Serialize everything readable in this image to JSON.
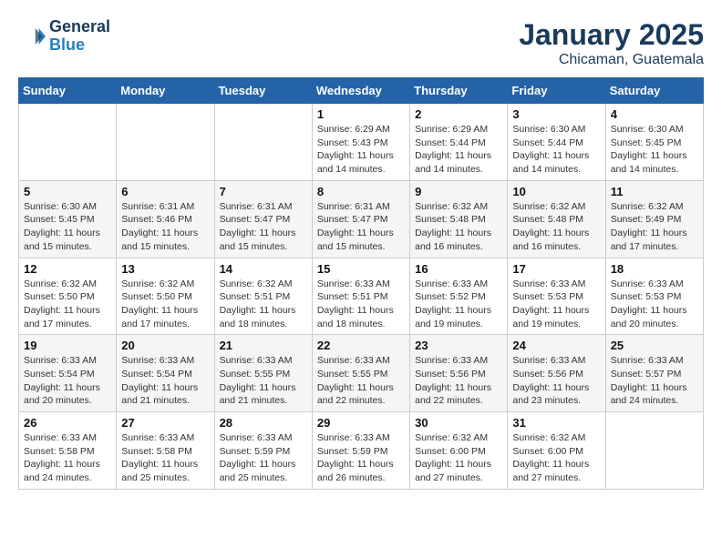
{
  "header": {
    "logo_line1": "General",
    "logo_line2": "Blue",
    "month": "January 2025",
    "location": "Chicaman, Guatemala"
  },
  "weekdays": [
    "Sunday",
    "Monday",
    "Tuesday",
    "Wednesday",
    "Thursday",
    "Friday",
    "Saturday"
  ],
  "weeks": [
    [
      {
        "day": "",
        "sunrise": "",
        "sunset": "",
        "daylight": ""
      },
      {
        "day": "",
        "sunrise": "",
        "sunset": "",
        "daylight": ""
      },
      {
        "day": "",
        "sunrise": "",
        "sunset": "",
        "daylight": ""
      },
      {
        "day": "1",
        "sunrise": "Sunrise: 6:29 AM",
        "sunset": "Sunset: 5:43 PM",
        "daylight": "Daylight: 11 hours and 14 minutes."
      },
      {
        "day": "2",
        "sunrise": "Sunrise: 6:29 AM",
        "sunset": "Sunset: 5:44 PM",
        "daylight": "Daylight: 11 hours and 14 minutes."
      },
      {
        "day": "3",
        "sunrise": "Sunrise: 6:30 AM",
        "sunset": "Sunset: 5:44 PM",
        "daylight": "Daylight: 11 hours and 14 minutes."
      },
      {
        "day": "4",
        "sunrise": "Sunrise: 6:30 AM",
        "sunset": "Sunset: 5:45 PM",
        "daylight": "Daylight: 11 hours and 14 minutes."
      }
    ],
    [
      {
        "day": "5",
        "sunrise": "Sunrise: 6:30 AM",
        "sunset": "Sunset: 5:45 PM",
        "daylight": "Daylight: 11 hours and 15 minutes."
      },
      {
        "day": "6",
        "sunrise": "Sunrise: 6:31 AM",
        "sunset": "Sunset: 5:46 PM",
        "daylight": "Daylight: 11 hours and 15 minutes."
      },
      {
        "day": "7",
        "sunrise": "Sunrise: 6:31 AM",
        "sunset": "Sunset: 5:47 PM",
        "daylight": "Daylight: 11 hours and 15 minutes."
      },
      {
        "day": "8",
        "sunrise": "Sunrise: 6:31 AM",
        "sunset": "Sunset: 5:47 PM",
        "daylight": "Daylight: 11 hours and 15 minutes."
      },
      {
        "day": "9",
        "sunrise": "Sunrise: 6:32 AM",
        "sunset": "Sunset: 5:48 PM",
        "daylight": "Daylight: 11 hours and 16 minutes."
      },
      {
        "day": "10",
        "sunrise": "Sunrise: 6:32 AM",
        "sunset": "Sunset: 5:48 PM",
        "daylight": "Daylight: 11 hours and 16 minutes."
      },
      {
        "day": "11",
        "sunrise": "Sunrise: 6:32 AM",
        "sunset": "Sunset: 5:49 PM",
        "daylight": "Daylight: 11 hours and 17 minutes."
      }
    ],
    [
      {
        "day": "12",
        "sunrise": "Sunrise: 6:32 AM",
        "sunset": "Sunset: 5:50 PM",
        "daylight": "Daylight: 11 hours and 17 minutes."
      },
      {
        "day": "13",
        "sunrise": "Sunrise: 6:32 AM",
        "sunset": "Sunset: 5:50 PM",
        "daylight": "Daylight: 11 hours and 17 minutes."
      },
      {
        "day": "14",
        "sunrise": "Sunrise: 6:32 AM",
        "sunset": "Sunset: 5:51 PM",
        "daylight": "Daylight: 11 hours and 18 minutes."
      },
      {
        "day": "15",
        "sunrise": "Sunrise: 6:33 AM",
        "sunset": "Sunset: 5:51 PM",
        "daylight": "Daylight: 11 hours and 18 minutes."
      },
      {
        "day": "16",
        "sunrise": "Sunrise: 6:33 AM",
        "sunset": "Sunset: 5:52 PM",
        "daylight": "Daylight: 11 hours and 19 minutes."
      },
      {
        "day": "17",
        "sunrise": "Sunrise: 6:33 AM",
        "sunset": "Sunset: 5:53 PM",
        "daylight": "Daylight: 11 hours and 19 minutes."
      },
      {
        "day": "18",
        "sunrise": "Sunrise: 6:33 AM",
        "sunset": "Sunset: 5:53 PM",
        "daylight": "Daylight: 11 hours and 20 minutes."
      }
    ],
    [
      {
        "day": "19",
        "sunrise": "Sunrise: 6:33 AM",
        "sunset": "Sunset: 5:54 PM",
        "daylight": "Daylight: 11 hours and 20 minutes."
      },
      {
        "day": "20",
        "sunrise": "Sunrise: 6:33 AM",
        "sunset": "Sunset: 5:54 PM",
        "daylight": "Daylight: 11 hours and 21 minutes."
      },
      {
        "day": "21",
        "sunrise": "Sunrise: 6:33 AM",
        "sunset": "Sunset: 5:55 PM",
        "daylight": "Daylight: 11 hours and 21 minutes."
      },
      {
        "day": "22",
        "sunrise": "Sunrise: 6:33 AM",
        "sunset": "Sunset: 5:55 PM",
        "daylight": "Daylight: 11 hours and 22 minutes."
      },
      {
        "day": "23",
        "sunrise": "Sunrise: 6:33 AM",
        "sunset": "Sunset: 5:56 PM",
        "daylight": "Daylight: 11 hours and 22 minutes."
      },
      {
        "day": "24",
        "sunrise": "Sunrise: 6:33 AM",
        "sunset": "Sunset: 5:56 PM",
        "daylight": "Daylight: 11 hours and 23 minutes."
      },
      {
        "day": "25",
        "sunrise": "Sunrise: 6:33 AM",
        "sunset": "Sunset: 5:57 PM",
        "daylight": "Daylight: 11 hours and 24 minutes."
      }
    ],
    [
      {
        "day": "26",
        "sunrise": "Sunrise: 6:33 AM",
        "sunset": "Sunset: 5:58 PM",
        "daylight": "Daylight: 11 hours and 24 minutes."
      },
      {
        "day": "27",
        "sunrise": "Sunrise: 6:33 AM",
        "sunset": "Sunset: 5:58 PM",
        "daylight": "Daylight: 11 hours and 25 minutes."
      },
      {
        "day": "28",
        "sunrise": "Sunrise: 6:33 AM",
        "sunset": "Sunset: 5:59 PM",
        "daylight": "Daylight: 11 hours and 25 minutes."
      },
      {
        "day": "29",
        "sunrise": "Sunrise: 6:33 AM",
        "sunset": "Sunset: 5:59 PM",
        "daylight": "Daylight: 11 hours and 26 minutes."
      },
      {
        "day": "30",
        "sunrise": "Sunrise: 6:32 AM",
        "sunset": "Sunset: 6:00 PM",
        "daylight": "Daylight: 11 hours and 27 minutes."
      },
      {
        "day": "31",
        "sunrise": "Sunrise: 6:32 AM",
        "sunset": "Sunset: 6:00 PM",
        "daylight": "Daylight: 11 hours and 27 minutes."
      },
      {
        "day": "",
        "sunrise": "",
        "sunset": "",
        "daylight": ""
      }
    ]
  ]
}
